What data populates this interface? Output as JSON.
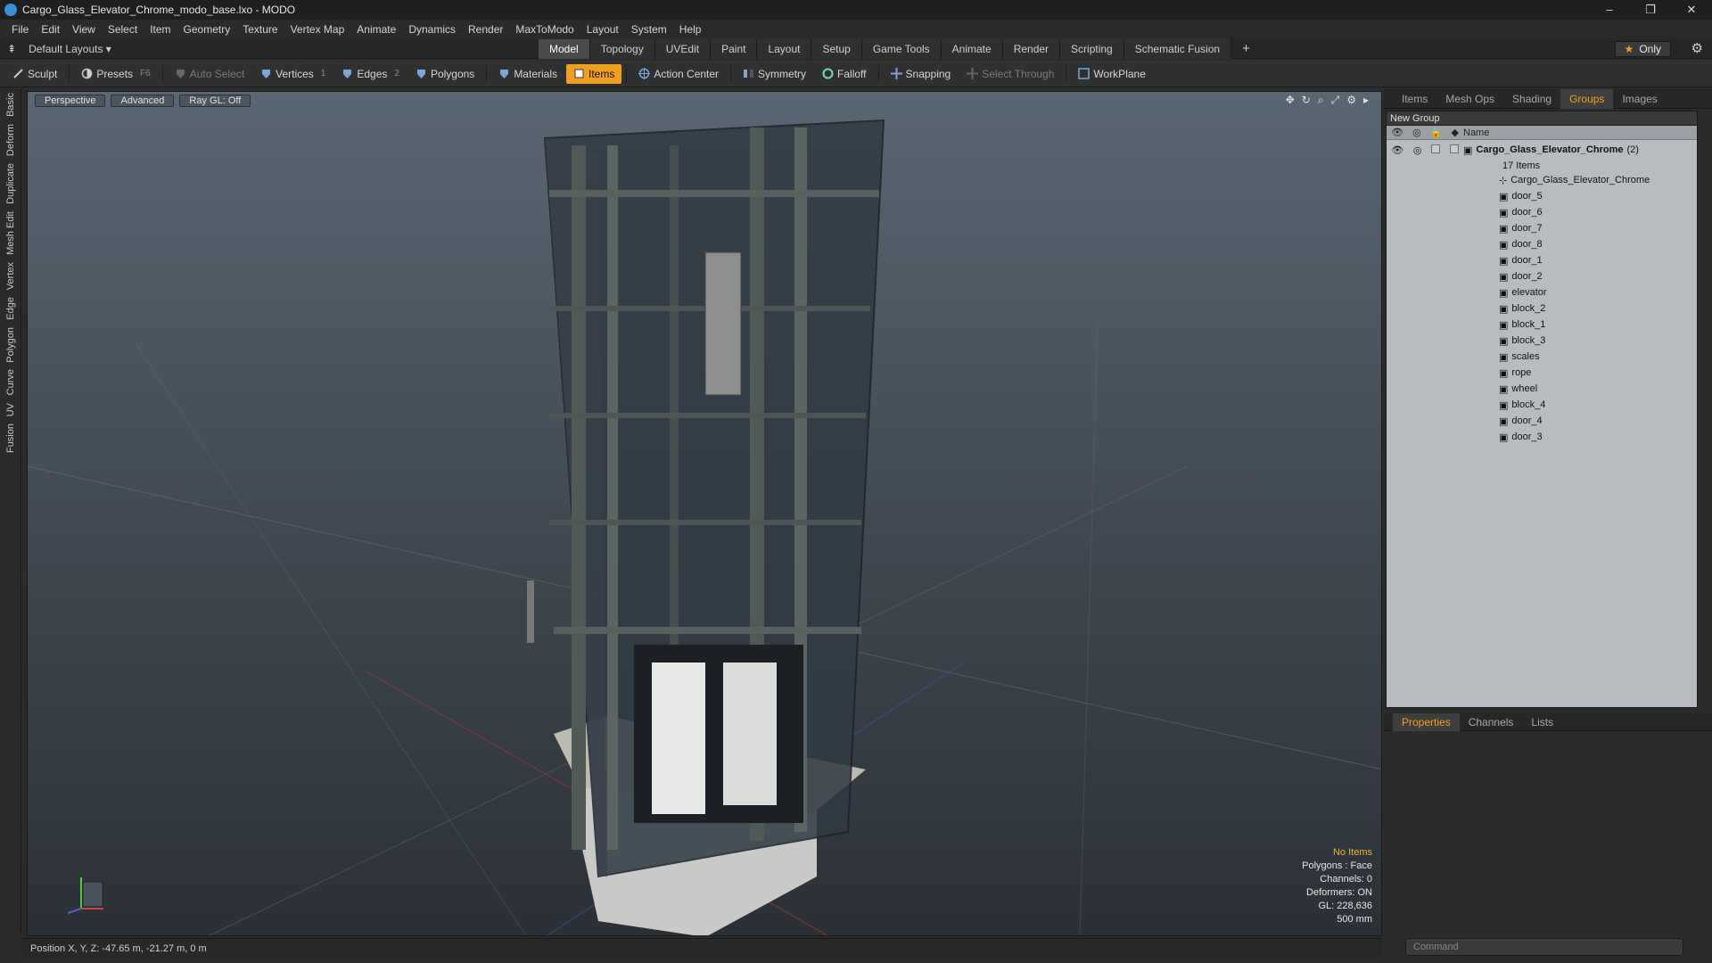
{
  "window": {
    "title": "Cargo_Glass_Elevator_Chrome_modo_base.lxo - MODO",
    "minimize": "–",
    "restore": "❐",
    "close": "✕"
  },
  "menu": [
    "File",
    "Edit",
    "View",
    "Select",
    "Item",
    "Geometry",
    "Texture",
    "Vertex Map",
    "Animate",
    "Dynamics",
    "Render",
    "MaxToModo",
    "Layout",
    "System",
    "Help"
  ],
  "layoutbar": {
    "layout_label": "Default Layouts ▾",
    "tabs": [
      "Model",
      "Topology",
      "UVEdit",
      "Paint",
      "Layout",
      "Setup",
      "Game Tools",
      "Animate",
      "Render",
      "Scripting",
      "Schematic Fusion"
    ],
    "active_tab": "Model",
    "add": "+",
    "only": "Only"
  },
  "toolbar": {
    "sculpt": "Sculpt",
    "presets": "Presets",
    "presets_key": "F6",
    "auto_select": "Auto Select",
    "vertices": "Vertices",
    "vertices_key": "1",
    "edges": "Edges",
    "edges_key": "2",
    "polygons": "Polygons",
    "materials": "Materials",
    "items": "Items",
    "action_center": "Action Center",
    "symmetry": "Symmetry",
    "falloff": "Falloff",
    "snapping": "Snapping",
    "select_through": "Select Through",
    "workplane": "WorkPlane"
  },
  "lefttabs": [
    "Basic",
    "Deform",
    "Duplicate",
    "Mesh Edit",
    "Vertex",
    "Edge",
    "Polygon",
    "Curve",
    "UV",
    "Fusion"
  ],
  "viewport": {
    "view": "Perspective",
    "mode": "Advanced",
    "raygl": "Ray GL: Off",
    "info": {
      "items": "No Items",
      "polygons": "Polygons : Face",
      "channels": "Channels: 0",
      "deformers": "Deformers: ON",
      "gl": "GL: 228,636",
      "scale": "500 mm"
    }
  },
  "status": {
    "position": "Position X, Y, Z:  -47.65 m, -21.27 m, 0 m"
  },
  "right_panel": {
    "tabs": [
      "Items",
      "Mesh Ops",
      "Shading",
      "Groups",
      "Images"
    ],
    "active_tab": "Groups",
    "new_group": "New Group",
    "name_header": "Name",
    "group": {
      "name": "Cargo_Glass_Elevator_Chrome",
      "count": "(2)",
      "sub": "17 Items"
    },
    "items": [
      "Cargo_Glass_Elevator_Chrome",
      "door_5",
      "door_6",
      "door_7",
      "door_8",
      "door_1",
      "door_2",
      "elevator",
      "block_2",
      "block_1",
      "block_3",
      "scales",
      "rope",
      "wheel",
      "block_4",
      "door_4",
      "door_3"
    ],
    "bottom_tabs": [
      "Properties",
      "Channels",
      "Lists"
    ],
    "bottom_active": "Properties",
    "command_placeholder": "Command"
  },
  "colors": {
    "accent": "#f0a020",
    "viewport_top": "#596673",
    "viewport_bottom": "#2b3036"
  }
}
